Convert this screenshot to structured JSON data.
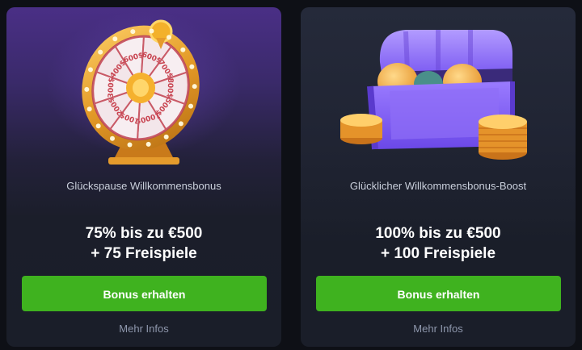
{
  "cards": [
    {
      "subtitle": "Glückspause Willkommensbonus",
      "offer_line1": "75% bis zu €500",
      "offer_line2": "+ 75 Freispiele",
      "button_label": "Bonus erhalten",
      "more_label": "Mehr Infos",
      "image_icon": "fortune-wheel-icon",
      "wheel_values": [
        "500$",
        "1000$",
        "100$",
        "200$",
        "300$",
        "400$",
        "600$",
        "600$",
        "700$",
        "800$"
      ]
    },
    {
      "subtitle": "Glücklicher Willkommensbonus-Boost",
      "offer_line1": "100% bis zu €500",
      "offer_line2": "+ 100 Freispiele",
      "button_label": "Bonus erhalten",
      "more_label": "Mehr Infos",
      "image_icon": "treasure-chest-icon"
    }
  ],
  "colors": {
    "page_bg": "#0e1016",
    "card_bg": "#1a1e29",
    "button": "#3fb21f",
    "text_primary": "#ffffff",
    "text_secondary": "#c9cfdb",
    "link": "#8f98ad"
  }
}
